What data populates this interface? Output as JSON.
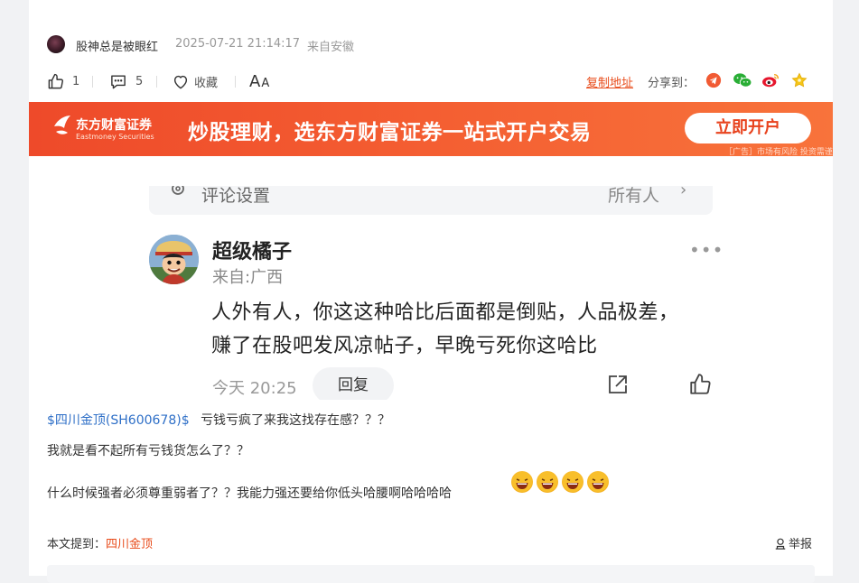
{
  "post": {
    "author": "股神总是被眼红",
    "time": "2025-07-21 21:14:17",
    "source": "来自安徽"
  },
  "actions": {
    "like_count": "1",
    "comment_count": "5",
    "favorite_label": "收藏",
    "font_label": "A",
    "font_label_small": "A",
    "copy_link": "复制地址",
    "share_label": "分享到："
  },
  "share_icons": [
    "telegram-icon",
    "wechat-icon",
    "weibo-icon",
    "favorite-star-icon"
  ],
  "banner": {
    "brand": "东方财富证券",
    "brand_en": "Eastmoney Securities",
    "slogan": "炒股理财，选东方财富证券一站式开户交易",
    "button": "立即开户",
    "disclaimer": "［广告］市场有风险 投资需谨慎"
  },
  "screenshot": {
    "settings_label": "评论设置",
    "settings_value": "所有人",
    "commenter": "超级橘子",
    "location": "来自:广西",
    "comment_line1": "人外有人，你这这种哈比后面都是倒贴，人品极差，",
    "comment_line2": "赚了在股吧发风凉帖子，早晚亏死你这哈比",
    "time": "今天 20:25",
    "reply": "回复"
  },
  "body": {
    "stock_link": "$四川金顶(SH600678)$",
    "line1_rest": "亏钱亏疯了来我这找存在感？？？",
    "line2": "我就是看不起所有亏钱货怎么了？？",
    "line3": "什么时候强者必须尊重弱者了？？我能力强还要给你低头哈腰啊哈哈哈哈",
    "emoji_count": 4
  },
  "footer": {
    "mentions_label": "本文提到：",
    "mentions_stock": "四川金顶",
    "report": "举报"
  },
  "colors": {
    "accent": "#e84b1a",
    "link_blue": "#2e6fc7",
    "banner": "#f35a30"
  }
}
